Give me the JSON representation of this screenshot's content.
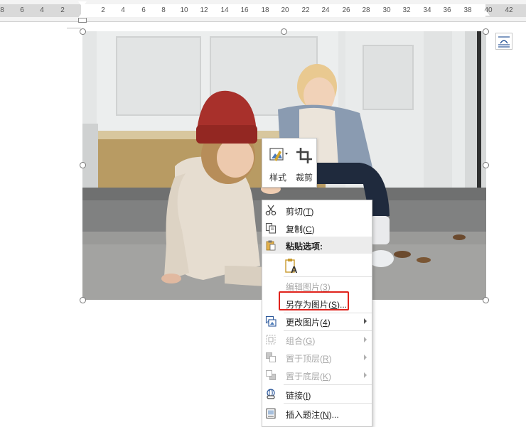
{
  "ruler": {
    "left_numbers": [
      "8",
      "6",
      "4",
      "2"
    ],
    "right_numbers": [
      "2",
      "4",
      "6",
      "8",
      "10",
      "12",
      "14",
      "16",
      "18",
      "20",
      "22",
      "24",
      "26",
      "28",
      "30",
      "32",
      "34",
      "36",
      "38",
      "40",
      "42"
    ]
  },
  "mini_toolbar": {
    "style_label": "样式",
    "crop_label": "裁剪"
  },
  "context_menu": {
    "cut": {
      "label": "剪切(",
      "key": "T",
      "end": ")"
    },
    "copy": {
      "label": "复制(",
      "key": "C",
      "end": ")"
    },
    "paste_header": "粘贴选项:",
    "edit_picture": {
      "label": "编辑图片(",
      "key": "3",
      "end": ")"
    },
    "save_as_picture": {
      "label": "另存为图片(",
      "key": "S",
      "end": ")..."
    },
    "change_picture": {
      "label": "更改图片(",
      "key": "4",
      "end": ")"
    },
    "group": {
      "label": "组合(",
      "key": "G",
      "end": ")"
    },
    "bring_to_front": {
      "label": "置于顶层(",
      "key": "R",
      "end": ")"
    },
    "send_to_back": {
      "label": "置于底层(",
      "key": "K",
      "end": ")"
    },
    "link": {
      "label": "链接(",
      "key": "I",
      "end": ")"
    },
    "insert_caption": {
      "label": "插入题注(",
      "key": "N",
      "end": ")..."
    }
  },
  "colors": {
    "highlight": "#e0231c",
    "icon_blue": "#2b579a",
    "hat_red": "#a8302b"
  }
}
